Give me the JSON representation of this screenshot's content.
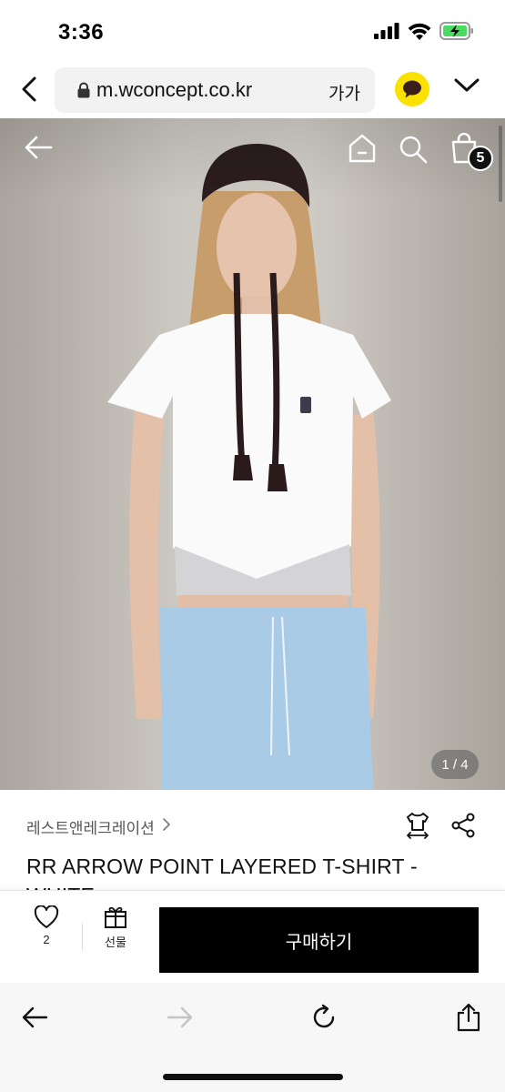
{
  "status_bar": {
    "time": "3:36",
    "icons": [
      "cellular-signal-icon",
      "wifi-icon",
      "battery-charging-icon"
    ],
    "battery_color": "#4cd964"
  },
  "browser": {
    "url": "m.wconcept.co.kr",
    "text_size_label": "가가",
    "icons": [
      "back-chevron-icon",
      "lock-icon",
      "kakao-talk-icon",
      "chevron-down-icon"
    ],
    "kakao_color": "#fae100"
  },
  "hero": {
    "image_counter": "1 / 4",
    "cart_count": "5",
    "icons": [
      "back-arrow-icon",
      "home-icon",
      "search-icon",
      "shopping-bag-icon"
    ]
  },
  "product": {
    "brand": "레스트앤레크레이션",
    "brand_chevron": "›",
    "title": "RR ARROW POINT LAYERED T-SHIRT - WHITE",
    "icons": [
      "size-guide-shirt-icon",
      "share-icon"
    ]
  },
  "purchase_bar": {
    "like_count": "2",
    "gift_label": "선물",
    "buy_label": "구매하기",
    "buy_color": "#000000"
  },
  "safari_toolbar": {
    "icons": [
      "back-arrow-icon",
      "forward-arrow-icon",
      "reload-icon",
      "share-icon"
    ]
  }
}
